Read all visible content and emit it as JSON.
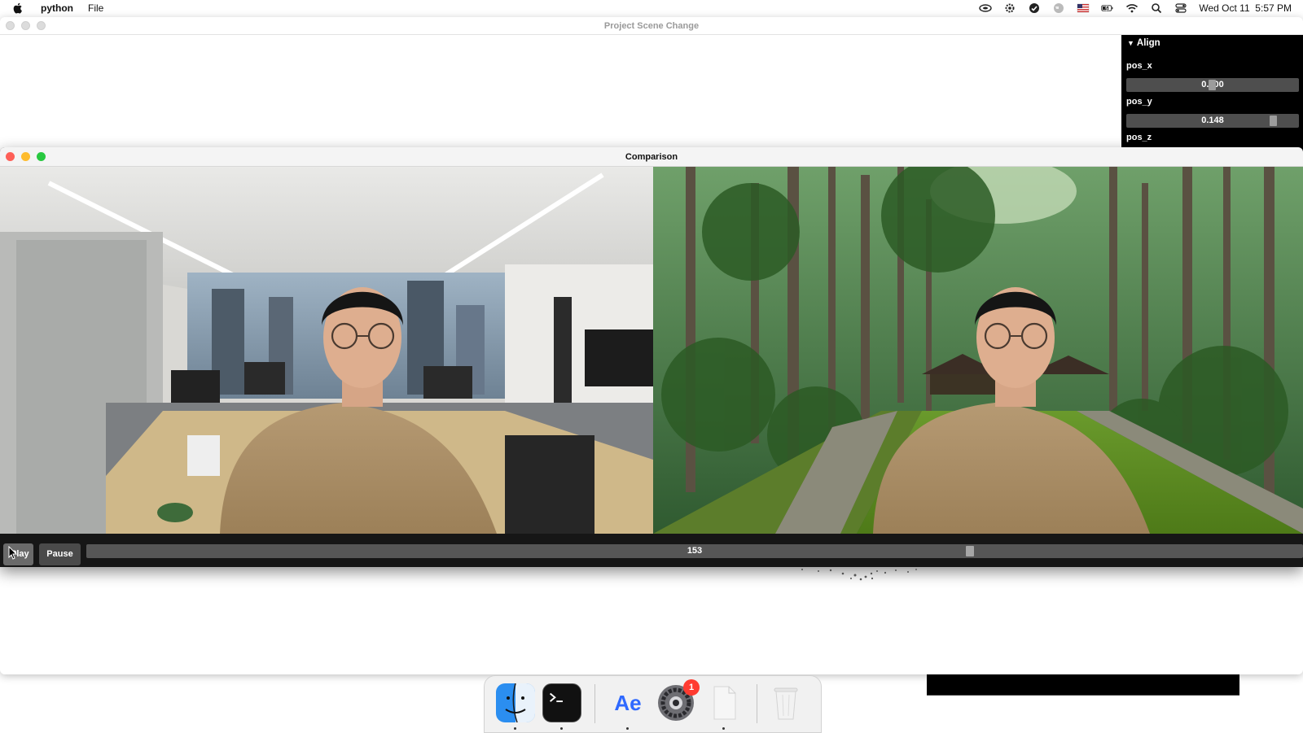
{
  "menubar": {
    "app_name": "python",
    "menus": [
      "File"
    ],
    "datetime": "Wed Oct 11  5:57 PM",
    "status_icons": [
      "cloud-icon",
      "gear-icon",
      "sync-icon",
      "globe-icon",
      "us-flag-icon",
      "battery-icon",
      "wifi-icon",
      "spotlight-search-icon",
      "control-center-icon"
    ]
  },
  "back_window": {
    "title": "Project Scene Change",
    "panel": {
      "header": "Align",
      "params": [
        {
          "label": "pos_x",
          "value": "0.000",
          "fraction": 0.5
        },
        {
          "label": "pos_y",
          "value": "0.148",
          "fraction": 0.87
        },
        {
          "label": "pos_z"
        }
      ]
    }
  },
  "front_window": {
    "title": "Comparison",
    "left_view": "office-background-video",
    "right_view": "forest-background-video",
    "controls": {
      "play_label": "Play",
      "pause_label": "Pause",
      "frame_value": "153",
      "frame_fraction": 0.728
    }
  },
  "dock": {
    "apps": [
      {
        "name": "finder-icon",
        "running": true
      },
      {
        "name": "terminal-icon",
        "running": true
      },
      {
        "name": "after-effects-icon",
        "label": "Ae",
        "running": true
      },
      {
        "name": "system-settings-icon",
        "badge": "1",
        "running": false
      },
      {
        "name": "blank-document-icon",
        "running": true
      },
      {
        "name": "trash-icon",
        "running": false
      }
    ]
  },
  "colors": {
    "panel_bg": "#000000",
    "slider_bg": "#4e4e4e",
    "traffic_red": "#fe5f57",
    "traffic_yellow": "#febc2e",
    "traffic_green": "#28c840",
    "ae_blue": "#2f69ff",
    "badge_red": "#ff3b30"
  }
}
